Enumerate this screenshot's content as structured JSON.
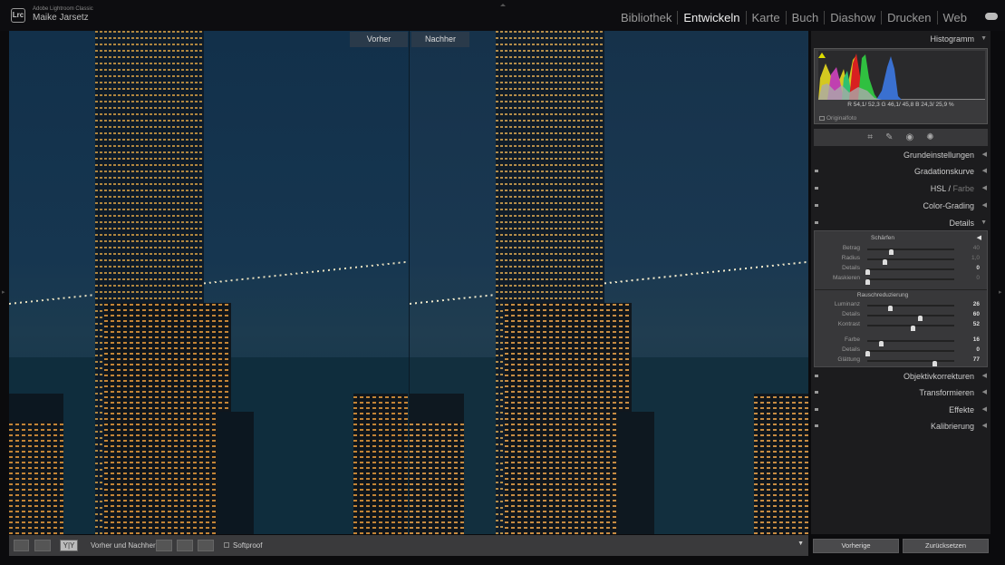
{
  "app": {
    "product": "Adobe Lightroom Classic",
    "logo": "Lrc",
    "user": "Maike Jarsetz"
  },
  "modules": [
    {
      "label": "Bibliothek"
    },
    {
      "label": "Entwickeln",
      "active": true
    },
    {
      "label": "Karte"
    },
    {
      "label": "Buch"
    },
    {
      "label": "Diashow"
    },
    {
      "label": "Drucken"
    },
    {
      "label": "Web"
    }
  ],
  "view": {
    "before_label": "Vorher",
    "after_label": "Nachher"
  },
  "histogram": {
    "title": "Histogramm",
    "readout": "R 54,1/ 52,3  G 46,1/ 45,8  B 24,3/ 25,9 %",
    "original": "Originalfoto"
  },
  "panels": {
    "grund": "Grundeinstellungen",
    "grad": "Gradationskurve",
    "hsl": "HSL",
    "farbe": "Farbe",
    "color": "Color-Grading",
    "details": "Details",
    "objektiv": "Objektivkorrekturen",
    "trans": "Transformieren",
    "effekte": "Effekte",
    "kalib": "Kalibrierung"
  },
  "details": {
    "sharpen_title": "Schärfen",
    "sharpen": [
      {
        "label": "Betrag",
        "value": "40",
        "pos": 0.27,
        "dim": true
      },
      {
        "label": "Radius",
        "value": "1,0",
        "pos": 0.2,
        "dim": true
      },
      {
        "label": "Details",
        "value": "0",
        "pos": 0
      },
      {
        "label": "Maskieren",
        "value": "0",
        "pos": 0,
        "dim": true
      }
    ],
    "noise_title": "Rauschreduzierung",
    "noise": [
      {
        "label": "Luminanz",
        "value": "26",
        "pos": 0.26
      },
      {
        "label": "Details",
        "value": "60",
        "pos": 0.6
      },
      {
        "label": "Kontrast",
        "value": "52",
        "pos": 0.52
      },
      {
        "label": "Farbe",
        "value": "16",
        "pos": 0.16
      },
      {
        "label": "Details",
        "value": "0",
        "pos": 0
      },
      {
        "label": "Glättung",
        "value": "77",
        "pos": 0.77
      }
    ]
  },
  "toolbar": {
    "before_after_label": "Vorher und Nachher:",
    "softproof": "Softproof",
    "yy": "Y|Y"
  },
  "buttons": {
    "previous": "Vorherige",
    "reset": "Zurücksetzen"
  }
}
